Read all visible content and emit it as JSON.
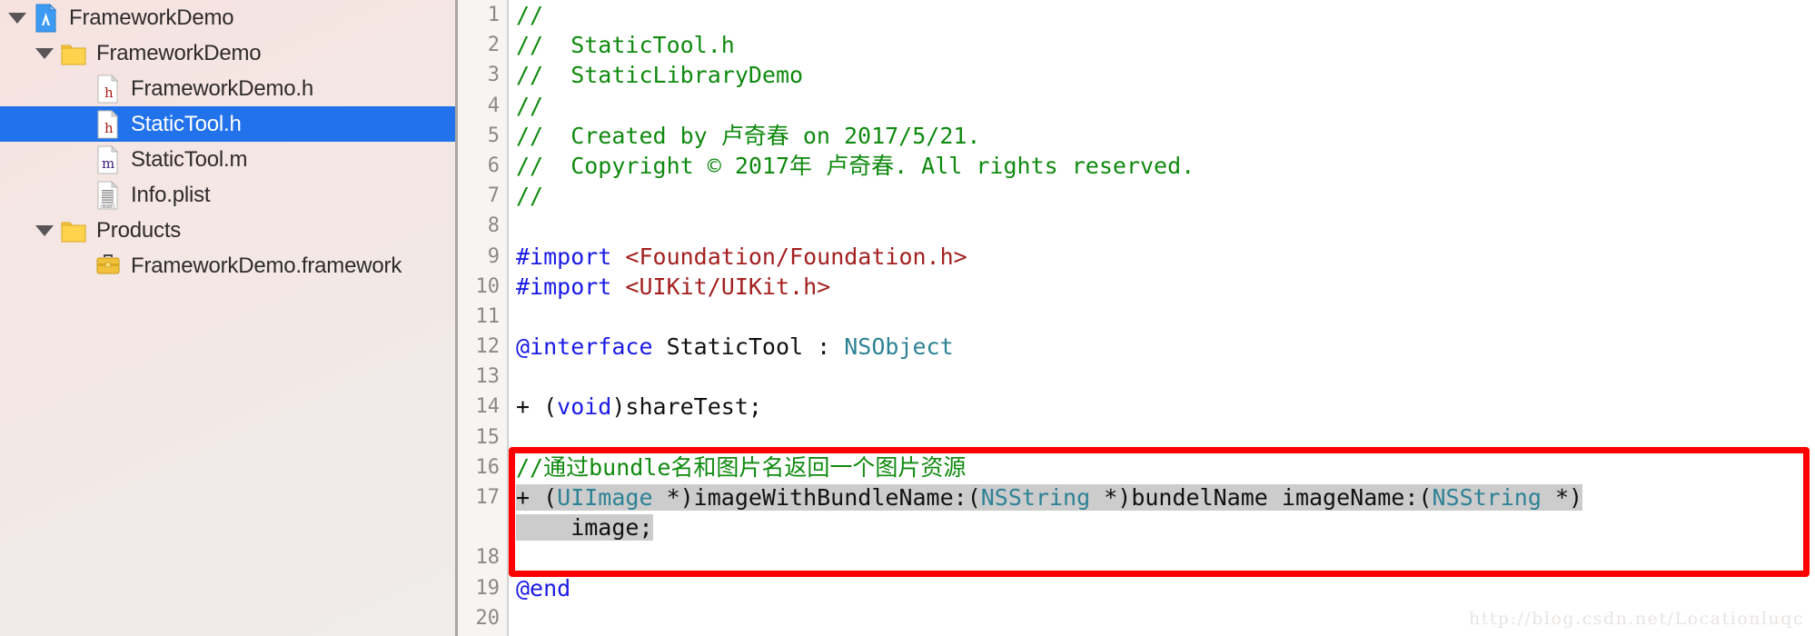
{
  "navigator": {
    "rows": [
      {
        "label": "FrameworkDemo",
        "depth": 0,
        "disclosure": "expanded",
        "icon": "xcode-project-icon",
        "selected": false
      },
      {
        "label": "FrameworkDemo",
        "depth": 1,
        "disclosure": "expanded",
        "icon": "folder-icon",
        "selected": false
      },
      {
        "label": "FrameworkDemo.h",
        "depth": 2,
        "disclosure": "none",
        "icon": "header-file-icon",
        "selected": false
      },
      {
        "label": "StaticTool.h",
        "depth": 2,
        "disclosure": "none",
        "icon": "header-file-icon",
        "selected": true
      },
      {
        "label": "StaticTool.m",
        "depth": 2,
        "disclosure": "none",
        "icon": "source-file-icon",
        "selected": false
      },
      {
        "label": "Info.plist",
        "depth": 2,
        "disclosure": "none",
        "icon": "plist-file-icon",
        "selected": false
      },
      {
        "label": "Products",
        "depth": 1,
        "disclosure": "expanded",
        "icon": "folder-icon",
        "selected": false
      },
      {
        "label": "FrameworkDemo.framework",
        "depth": 2,
        "disclosure": "none",
        "icon": "framework-icon",
        "selected": false
      }
    ]
  },
  "editor": {
    "gutter_numbers": [
      "1",
      "2",
      "3",
      "4",
      "5",
      "6",
      "7",
      "8",
      "9",
      "10",
      "11",
      "12",
      "13",
      "14",
      "15",
      "16",
      "17",
      "18",
      "19",
      "20"
    ],
    "lines": [
      {
        "n": "1",
        "tokens": [
          {
            "t": "//",
            "c": "comment"
          }
        ]
      },
      {
        "n": "2",
        "tokens": [
          {
            "t": "//  StaticTool.h",
            "c": "comment"
          }
        ]
      },
      {
        "n": "3",
        "tokens": [
          {
            "t": "//  StaticLibraryDemo",
            "c": "comment"
          }
        ]
      },
      {
        "n": "4",
        "tokens": [
          {
            "t": "//",
            "c": "comment"
          }
        ]
      },
      {
        "n": "5",
        "tokens": [
          {
            "t": "//  Created by 卢奇春 on 2017/5/21.",
            "c": "comment"
          }
        ]
      },
      {
        "n": "6",
        "tokens": [
          {
            "t": "//  Copyright © 2017年 卢奇春. All rights reserved.",
            "c": "comment"
          }
        ]
      },
      {
        "n": "7",
        "tokens": [
          {
            "t": "//",
            "c": "comment"
          }
        ]
      },
      {
        "n": "8",
        "tokens": []
      },
      {
        "n": "9",
        "tokens": [
          {
            "t": "#import ",
            "c": "pre"
          },
          {
            "t": "<Foundation/Foundation.h>",
            "c": "str"
          }
        ]
      },
      {
        "n": "10",
        "tokens": [
          {
            "t": "#import ",
            "c": "pre"
          },
          {
            "t": "<UIKit/UIKit.h>",
            "c": "str"
          }
        ]
      },
      {
        "n": "11",
        "tokens": []
      },
      {
        "n": "12",
        "tokens": [
          {
            "t": "@interface ",
            "c": "kw"
          },
          {
            "t": "StaticTool : ",
            "c": "plain"
          },
          {
            "t": "NSObject",
            "c": "type"
          }
        ]
      },
      {
        "n": "13",
        "tokens": []
      },
      {
        "n": "14",
        "tokens": [
          {
            "t": "+ (",
            "c": "plain"
          },
          {
            "t": "void",
            "c": "kw"
          },
          {
            "t": ")shareTest;",
            "c": "plain"
          }
        ]
      },
      {
        "n": "15",
        "tokens": []
      },
      {
        "n": "16",
        "tokens": [
          {
            "t": "//通过bundle名和图片名返回一个图片资源",
            "c": "comment"
          }
        ]
      },
      {
        "n": "17",
        "tokens": [
          {
            "t": "+ (",
            "c": "plain",
            "sel": true
          },
          {
            "t": "UIImage",
            "c": "type",
            "sel": true
          },
          {
            "t": " *)imageWithBundleName:(",
            "c": "plain",
            "sel": true
          },
          {
            "t": "NSString",
            "c": "type",
            "sel": true
          },
          {
            "t": " *)bundelName imageName:(",
            "c": "plain",
            "sel": true
          },
          {
            "t": "NSString",
            "c": "type",
            "sel": true
          },
          {
            "t": " *)",
            "c": "plain",
            "sel": true
          }
        ]
      },
      {
        "n": "",
        "wrapped": true,
        "tokens": [
          {
            "t": "    image;",
            "c": "plain",
            "sel": true
          }
        ]
      },
      {
        "n": "18",
        "tokens": []
      },
      {
        "n": "19",
        "tokens": [
          {
            "t": "@end",
            "c": "kw"
          }
        ]
      },
      {
        "n": "20",
        "tokens": []
      }
    ]
  },
  "annotation": {
    "red_box_label": "highlighted-method-declaration"
  },
  "watermark": {
    "text": "http://blog.csdn.net/Locationluqc"
  },
  "colors": {
    "selection_blue": "#2272ec",
    "comment_green": "#108a10",
    "preprocessor_blue": "#1a1ae6",
    "string_red": "#a32020",
    "type_teal": "#2d8295",
    "code_selection_gray": "#cccccc",
    "annotation_red": "#ff0000",
    "sidebar_bg": "#f4e7e4"
  }
}
